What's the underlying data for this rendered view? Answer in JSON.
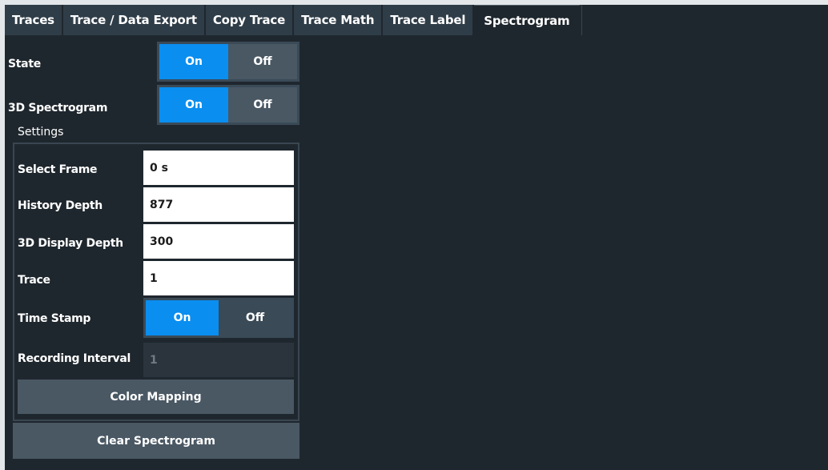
{
  "tabs": [
    {
      "label": "Traces"
    },
    {
      "label": "Trace / Data Export"
    },
    {
      "label": "Copy Trace"
    },
    {
      "label": "Trace Math"
    },
    {
      "label": "Trace Label"
    },
    {
      "label": "Spectrogram",
      "active": true
    }
  ],
  "state": {
    "label": "State",
    "on": "On",
    "off": "Off",
    "value": "On"
  },
  "spectrogram3d": {
    "label": "3D Spectrogram",
    "on": "On",
    "off": "Off",
    "value": "On"
  },
  "settings": {
    "title": "Settings",
    "select_frame": {
      "label": "Select Frame",
      "value": "0 s"
    },
    "history_depth": {
      "label": "History Depth",
      "value": "877"
    },
    "display_depth_3d": {
      "label": "3D Display Depth",
      "value": "300"
    },
    "trace": {
      "label": "Trace",
      "value": "1"
    },
    "time_stamp": {
      "label": "Time Stamp",
      "on": "On",
      "off": "Off",
      "value": "On"
    },
    "recording_interval": {
      "label": "Recording Interval",
      "value": "1"
    },
    "color_mapping": "Color Mapping"
  },
  "clear_spectrogram": "Clear Spectrogram",
  "colors": {
    "accent": "#0a8ef0",
    "background": "#1f272e",
    "button": "#4a5864"
  }
}
